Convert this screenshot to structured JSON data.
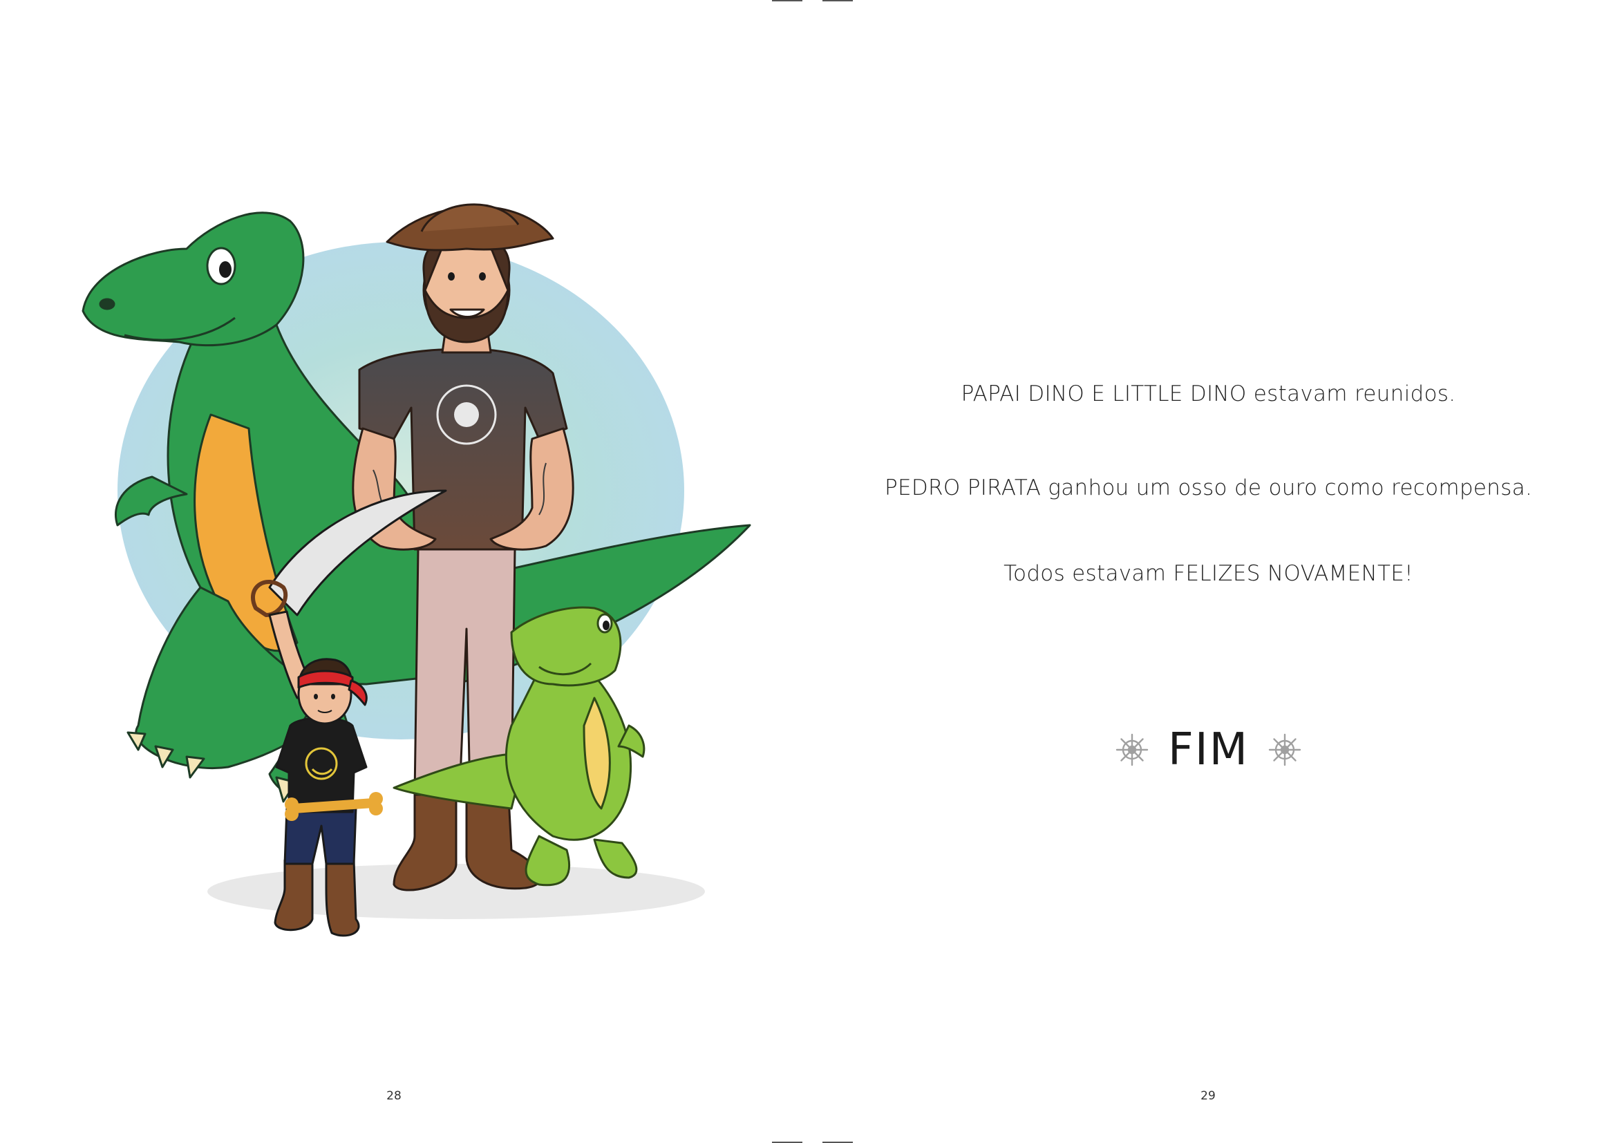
{
  "left_page": {
    "page_number": "28"
  },
  "right_page": {
    "page_number": "29",
    "story": [
      "PAPAI DINO E LITTLE DINO estavam reunidos.",
      "PEDRO PIRATA ganhou um osso de ouro como recompensa.",
      "Todos estavam FELIZES NOVAMENTE!"
    ],
    "ending": {
      "text": "FIM",
      "ornament_icon": "ship-wheel-icon"
    }
  },
  "colors": {
    "dino_green": "#2e9d4e",
    "dino_belly": "#f2a93b",
    "little_dino_green": "#8cc63f",
    "little_dino_belly": "#f3d36b",
    "hat_brown": "#7a4a2a",
    "shirt_gray": "#4a4a4e",
    "pants_pink": "#d9b9b4",
    "bandana_red": "#d8262a",
    "backdrop_teal": "#a8d8d6",
    "backdrop_blue": "#a9d3e6",
    "helm_gray": "#a0a0a0"
  }
}
